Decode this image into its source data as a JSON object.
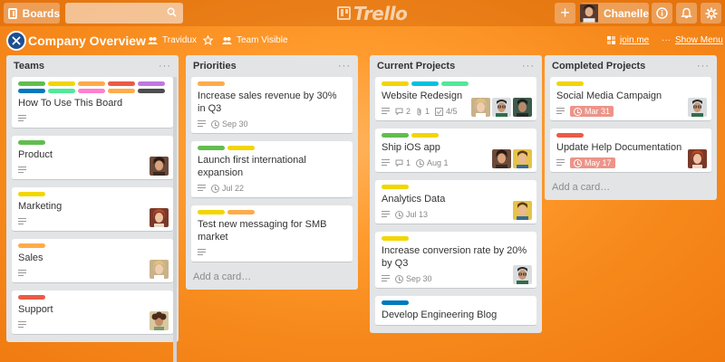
{
  "topbar": {
    "boards_label": "Boards",
    "search_placeholder": "",
    "logo_text": "Trello",
    "user_name": "Chanelle"
  },
  "board": {
    "title": "Company Overview",
    "team": "Travidux",
    "visibility": "Team Visible",
    "join_link": "join.me",
    "show_menu": "Show Menu"
  },
  "lists": [
    {
      "title": "Teams",
      "cards": [
        {
          "title": "How To Use This Board",
          "labels": [
            "#61bd4f",
            "#f2d600",
            "#ffab4a",
            "#eb5a46",
            "#c377e0",
            "#0079bf",
            "#51e898",
            "#ff80ce",
            "#ffab4a",
            "#4d4d4d"
          ],
          "description": true,
          "avatars": []
        },
        {
          "title": "Product",
          "labels": [
            "#61bd4f"
          ],
          "description": true,
          "avatars": [
            "brown"
          ]
        },
        {
          "title": "Marketing",
          "labels": [
            "#f2d600"
          ],
          "description": true,
          "avatars": [
            "red"
          ]
        },
        {
          "title": "Sales",
          "labels": [
            "#ffab4a"
          ],
          "description": true,
          "avatars": [
            "blonde"
          ]
        },
        {
          "title": "Support",
          "labels": [
            "#eb5a46"
          ],
          "description": true,
          "avatars": [
            "curly"
          ]
        }
      ]
    },
    {
      "title": "Priorities",
      "add_card": "Add a card…",
      "cards": [
        {
          "title": "Increase sales revenue by 30% in Q3",
          "labels": [
            "#ffab4a"
          ],
          "description": true,
          "due": "Sep 30",
          "avatars": []
        },
        {
          "title": "Launch first international expansion",
          "labels": [
            "#61bd4f",
            "#f2d600"
          ],
          "description": true,
          "due": "Jul 22",
          "avatars": []
        },
        {
          "title": "Test new messaging for SMB market",
          "labels": [
            "#f2d600",
            "#ffab4a"
          ],
          "description": true,
          "avatars": []
        }
      ]
    },
    {
      "title": "Current Projects",
      "cards": [
        {
          "title": "Website Redesign",
          "labels": [
            "#f2d600",
            "#00c2e0",
            "#51e898"
          ],
          "description": true,
          "comments": "2",
          "attachments": "1",
          "checklist": "4/5",
          "avatars": [
            "blonde",
            "glasses",
            "dark"
          ]
        },
        {
          "title": "Ship iOS app",
          "labels": [
            "#61bd4f",
            "#f2d600"
          ],
          "description": true,
          "comments": "1",
          "due": "Aug 1",
          "avatars": [
            "brown",
            "yellow"
          ]
        },
        {
          "title": "Analytics Data",
          "labels": [
            "#f2d600"
          ],
          "description": true,
          "due": "Jul 13",
          "avatars": [
            "yellow"
          ]
        },
        {
          "title": "Increase conversion rate by 20% by Q3",
          "labels": [
            "#f2d600"
          ],
          "description": true,
          "due": "Sep 30",
          "avatars": [
            "glasses"
          ]
        },
        {
          "title": "Develop Engineering Blog",
          "labels": [
            "#0079bf"
          ],
          "description": false,
          "avatars": []
        }
      ]
    },
    {
      "title": "Completed Projects",
      "add_card": "Add a card…",
      "cards": [
        {
          "title": "Social Media Campaign",
          "labels": [
            "#f2d600"
          ],
          "description": true,
          "due_red": "Mar 31",
          "avatars": [
            "glasses"
          ]
        },
        {
          "title": "Update Help Documentation",
          "labels": [
            "#eb5a46"
          ],
          "description": true,
          "due_red": "May 17",
          "avatars": [
            "red"
          ]
        }
      ]
    }
  ]
}
